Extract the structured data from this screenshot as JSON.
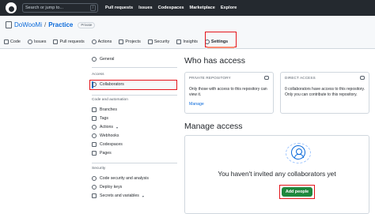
{
  "topbar": {
    "search_placeholder": "Search or jump to...",
    "search_shortcut": "/",
    "nav": [
      "Pull requests",
      "Issues",
      "Codespaces",
      "Marketplace",
      "Explore"
    ]
  },
  "repo": {
    "owner": "DoWooMi",
    "separator": "/",
    "name": "Practice",
    "visibility": "Private"
  },
  "tabs": [
    {
      "label": "Code",
      "icon": "code-icon"
    },
    {
      "label": "Issues",
      "icon": "issue-icon"
    },
    {
      "label": "Pull requests",
      "icon": "pull-request-icon"
    },
    {
      "label": "Actions",
      "icon": "play-icon"
    },
    {
      "label": "Projects",
      "icon": "table-icon"
    },
    {
      "label": "Security",
      "icon": "shield-icon"
    },
    {
      "label": "Insights",
      "icon": "graph-icon"
    },
    {
      "label": "Settings",
      "icon": "gear-icon",
      "active": true
    }
  ],
  "sidebar": {
    "general": "General",
    "access_heading": "Access",
    "collaborators": "Collaborators",
    "code_automation_heading": "Code and automation",
    "branches": "Branches",
    "tags": "Tags",
    "actions": "Actions",
    "webhooks": "Webhooks",
    "codespaces": "Codespaces",
    "pages": "Pages",
    "security_heading": "Security",
    "code_security": "Code security and analysis",
    "deploy_keys": "Deploy keys",
    "secrets_variables": "Secrets and variables"
  },
  "main": {
    "who_has_access": "Who has access",
    "private_card": {
      "title": "PRIVATE REPOSITORY",
      "text": "Only those with access to this repository can view it.",
      "link": "Manage"
    },
    "direct_card": {
      "title": "DIRECT ACCESS",
      "text": "0 collaborators have access to this repository. Only you can contribute to this repository."
    },
    "manage_access": "Manage access",
    "empty_message": "You haven't invited any collaborators yet",
    "add_people": "Add people"
  },
  "colors": {
    "header_bg": "#24292f",
    "accent_blue": "#0969da",
    "button_green": "#1f883d",
    "highlight_red": "#e5151c"
  }
}
